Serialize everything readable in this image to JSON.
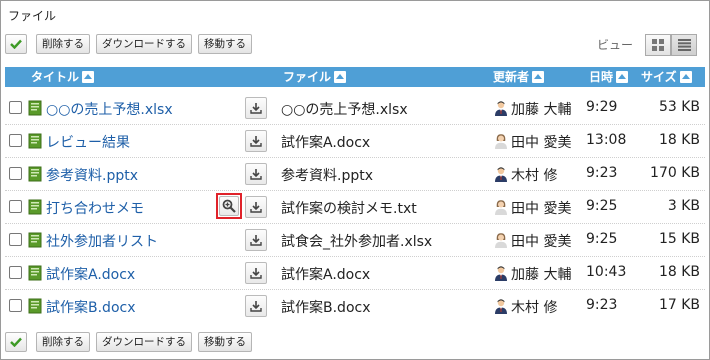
{
  "section_title": "ファイル",
  "toolbar": {
    "delete_label": "削除する",
    "download_label": "ダウンロードする",
    "move_label": "移動する"
  },
  "view": {
    "label": "ビュー",
    "modes": [
      "grid",
      "list"
    ],
    "active": "list"
  },
  "columns": {
    "title": "タイトル",
    "file": "ファイル",
    "updater": "更新者",
    "time": "日時",
    "size": "サイズ"
  },
  "rows": [
    {
      "title": "○○の売上予想.xlsx",
      "file": "○○の売上予想.xlsx",
      "updater": "加藤 大輔",
      "avatar": "male",
      "time": "9:29",
      "size": "53 KB",
      "preview": false
    },
    {
      "title": "レビュー結果",
      "file": "試作案A.docx",
      "updater": "田中 愛美",
      "avatar": "female",
      "time": "13:08",
      "size": "18 KB",
      "preview": false
    },
    {
      "title": "参考資料.pptx",
      "file": "参考資料.pptx",
      "updater": "木村 修",
      "avatar": "male",
      "time": "9:23",
      "size": "170 KB",
      "preview": false
    },
    {
      "title": "打ち合わせメモ",
      "file": "試作案の検討メモ.txt",
      "updater": "田中 愛美",
      "avatar": "female",
      "time": "9:25",
      "size": "3 KB",
      "preview": true
    },
    {
      "title": "社外参加者リスト",
      "file": "試食会_社外参加者.xlsx",
      "updater": "田中 愛美",
      "avatar": "female",
      "time": "9:25",
      "size": "15 KB",
      "preview": false
    },
    {
      "title": "試作案A.docx",
      "file": "試作案A.docx",
      "updater": "加藤 大輔",
      "avatar": "male",
      "time": "10:43",
      "size": "18 KB",
      "preview": false
    },
    {
      "title": "試作案B.docx",
      "file": "試作案B.docx",
      "updater": "木村 修",
      "avatar": "male",
      "time": "9:23",
      "size": "17 KB",
      "preview": false
    }
  ],
  "colors": {
    "header_bg": "#4f9fd6",
    "link": "#1e5fa8",
    "highlight": "#e0222a",
    "file_icon": "#5a9a2a"
  }
}
